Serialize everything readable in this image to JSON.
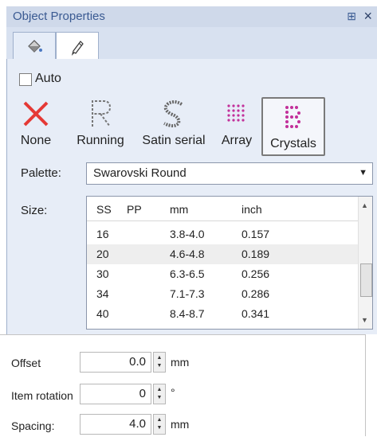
{
  "panel": {
    "title": "Object Properties",
    "pin_icon": "pin-icon",
    "close_label": "×"
  },
  "tabs": [
    {
      "icon": "fill-bucket-icon",
      "active": false
    },
    {
      "icon": "pen-nib-icon",
      "active": true
    }
  ],
  "auto": {
    "label": "Auto",
    "checked": false
  },
  "stitch_types": [
    {
      "label": "None",
      "icon": "red-x-icon",
      "selected": false
    },
    {
      "label": "Running",
      "icon": "running-r-icon",
      "selected": false
    },
    {
      "label": "Satin serial",
      "icon": "satin-s-icon",
      "selected": false
    },
    {
      "label": "Array",
      "icon": "array-grid-icon",
      "selected": false
    },
    {
      "label": "Crystals",
      "icon": "crystals-icon",
      "selected": true
    }
  ],
  "palette": {
    "label": "Palette:",
    "value": "Swarovski Round"
  },
  "size": {
    "label": "Size:",
    "columns": [
      "SS",
      "PP",
      "mm",
      "inch"
    ],
    "rows": [
      {
        "ss": "16",
        "pp": "",
        "mm": "3.8-4.0",
        "inch": "0.157"
      },
      {
        "ss": "20",
        "pp": "",
        "mm": "4.6-4.8",
        "inch": "0.189"
      },
      {
        "ss": "30",
        "pp": "",
        "mm": "6.3-6.5",
        "inch": "0.256"
      },
      {
        "ss": "34",
        "pp": "",
        "mm": "7.1-7.3",
        "inch": "0.286"
      },
      {
        "ss": "40",
        "pp": "",
        "mm": "8.4-8.7",
        "inch": "0.341"
      }
    ],
    "selected_index": 1
  },
  "offset": {
    "label": "Offset",
    "value": "0.0",
    "unit": "mm"
  },
  "item_rotation": {
    "label": "Item rotation",
    "value": "0",
    "unit": "°"
  },
  "spacing": {
    "label": "Spacing:",
    "value": "4.0",
    "unit": "mm"
  },
  "colors": {
    "accent": "#3a5a92",
    "none_red": "#e53935",
    "crystal_magenta": "#c2309a"
  }
}
